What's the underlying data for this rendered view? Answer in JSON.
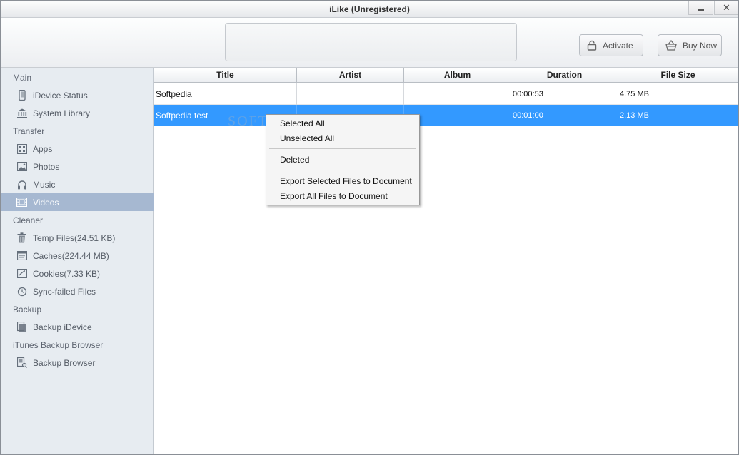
{
  "window": {
    "title": "iLike (Unregistered)"
  },
  "header": {
    "activate_label": "Activate",
    "buy_label": "Buy Now"
  },
  "sidebar": {
    "sections": [
      {
        "label": "Main",
        "items": [
          {
            "label": "iDevice Status",
            "icon": "phone-icon"
          },
          {
            "label": "System Library",
            "icon": "library-icon"
          }
        ]
      },
      {
        "label": "Transfer",
        "items": [
          {
            "label": "Apps",
            "icon": "apps-icon"
          },
          {
            "label": "Photos",
            "icon": "photo-icon"
          },
          {
            "label": "Music",
            "icon": "headphones-icon"
          },
          {
            "label": "Videos",
            "icon": "film-icon",
            "active": true
          }
        ]
      },
      {
        "label": "Cleaner",
        "items": [
          {
            "label": "Temp Files(24.51 KB)",
            "icon": "trash-icon"
          },
          {
            "label": "Caches(224.44 MB)",
            "icon": "cache-icon"
          },
          {
            "label": "Cookies(7.33 KB)",
            "icon": "cookie-icon"
          },
          {
            "label": "Sync-failed Files",
            "icon": "sync-icon"
          }
        ]
      },
      {
        "label": "Backup",
        "items": [
          {
            "label": "Backup iDevice",
            "icon": "backup-icon"
          }
        ]
      },
      {
        "label": "iTunes Backup Browser",
        "items": [
          {
            "label": "Backup Browser",
            "icon": "browser-icon"
          }
        ]
      }
    ]
  },
  "table": {
    "columns": [
      "Title",
      "Artist",
      "Album",
      "Duration",
      "File Size"
    ],
    "rows": [
      {
        "title": "Softpedia",
        "artist": "",
        "album": "",
        "duration": "00:00:53",
        "size": "4.75 MB"
      },
      {
        "title": "Softpedia test",
        "artist": "",
        "album": "",
        "duration": "00:01:00",
        "size": "2.13 MB"
      }
    ]
  },
  "context_menu": {
    "items": [
      "Selected All",
      "Unselected All",
      "Deleted",
      "Export Selected Files to Document",
      "Export All Files to Document"
    ]
  },
  "watermark": {
    "text": "SOFTPEDIA"
  },
  "colors": {
    "selection": "#3399ff",
    "sidebar_active": "#a6b8d1",
    "sidebar_bg": "#e7ecf1"
  }
}
